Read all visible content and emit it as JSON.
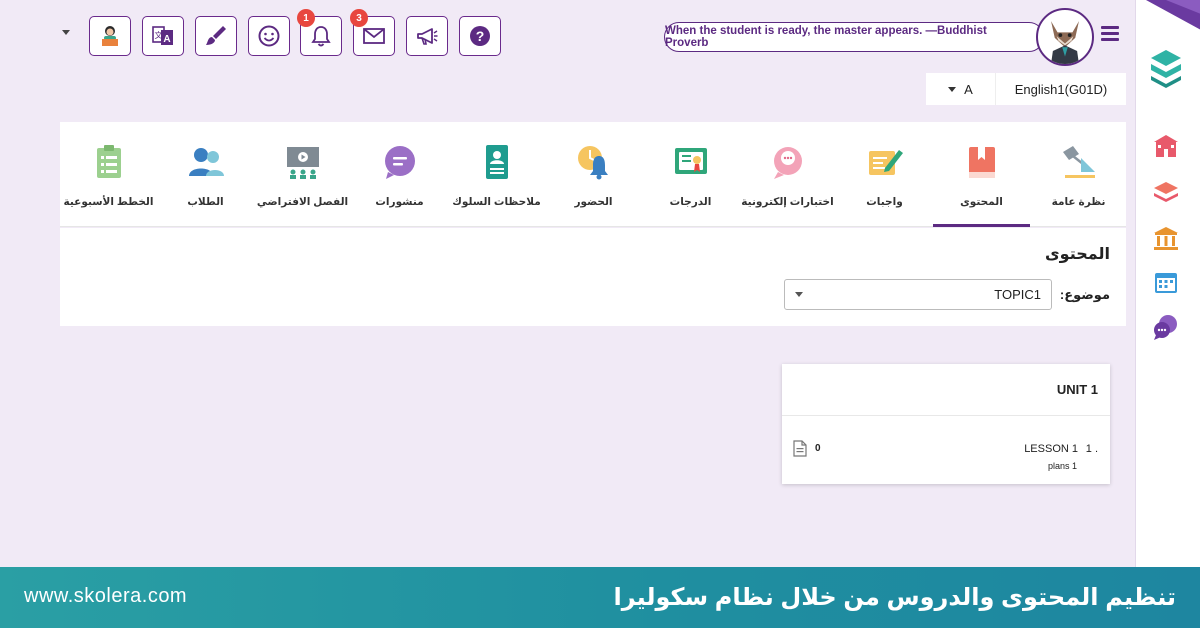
{
  "toolbar": {
    "notifications_count": "1",
    "messages_count": "3"
  },
  "header": {
    "quote": "When the student is ready, the master appears. —Buddhist Proverb"
  },
  "section_selector": {
    "section": "A",
    "course": "English1(G01D)"
  },
  "tabs": [
    {
      "label": "نظرة عامة",
      "icon": "lamp-icon"
    },
    {
      "label": "المحتوى",
      "icon": "book-icon",
      "active": true
    },
    {
      "label": "واجبات",
      "icon": "homework-icon"
    },
    {
      "label": "اختبارات إلكترونية",
      "icon": "online-quiz-icon"
    },
    {
      "label": "الدرجات",
      "icon": "grades-icon"
    },
    {
      "label": "الحضور",
      "icon": "attendance-icon"
    },
    {
      "label": "ملاحظات السلوك",
      "icon": "behavior-notes-icon"
    },
    {
      "label": "منشورات",
      "icon": "posts-icon"
    },
    {
      "label": "الفصل الافتراضي",
      "icon": "virtual-class-icon"
    },
    {
      "label": "الطلاب",
      "icon": "students-icon"
    },
    {
      "label": "الخطط الأسبوعية",
      "icon": "weekly-plans-icon"
    }
  ],
  "content": {
    "title": "المحتوى",
    "topic_label": "موضوع:",
    "topic_value": "TOPIC1"
  },
  "unit": {
    "title": "UNIT 1",
    "lessons": [
      {
        "number": "1 .",
        "name": "LESSON 1",
        "plans": "plans 1",
        "docs": "0"
      }
    ]
  },
  "banner": {
    "url": "www.skolera.com",
    "title": "تنظيم المحتوى والدروس من خلال نظام سكوليرا"
  },
  "colors": {
    "brand": "#5c2a82",
    "background": "#f1eaf6",
    "badge": "#e8473f",
    "banner": "#2a9fa4"
  }
}
